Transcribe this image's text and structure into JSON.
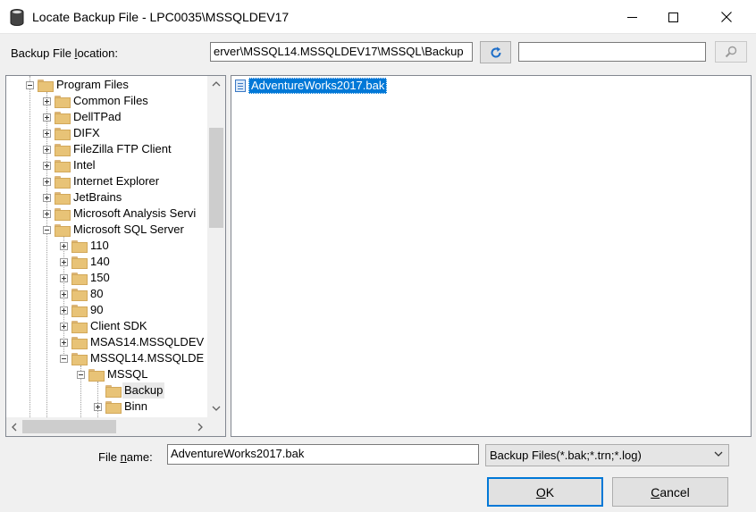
{
  "window": {
    "title": "Locate Backup File - LPC0035\\MSSQLDEV17",
    "icon": "database-icon"
  },
  "location": {
    "label_pre": "Backup File ",
    "label_key": "l",
    "label_post": "ocation:",
    "value": "erver\\MSSQL14.MSSQLDEV17\\MSSQL\\Backup",
    "search_value": ""
  },
  "tree": {
    "items": [
      {
        "label": "Program Files",
        "expander": "minus"
      },
      {
        "label": "Common Files",
        "expander": "plus"
      },
      {
        "label": "DellTPad",
        "expander": "plus"
      },
      {
        "label": "DIFX",
        "expander": "plus"
      },
      {
        "label": "FileZilla FTP Client",
        "expander": "plus"
      },
      {
        "label": "Intel",
        "expander": "plus"
      },
      {
        "label": "Internet Explorer",
        "expander": "plus"
      },
      {
        "label": "JetBrains",
        "expander": "plus"
      },
      {
        "label": "Microsoft Analysis Servi",
        "expander": "plus"
      },
      {
        "label": "Microsoft SQL Server",
        "expander": "minus"
      },
      {
        "label": "110",
        "expander": "plus"
      },
      {
        "label": "140",
        "expander": "plus"
      },
      {
        "label": "150",
        "expander": "plus"
      },
      {
        "label": "80",
        "expander": "plus"
      },
      {
        "label": "90",
        "expander": "plus"
      },
      {
        "label": "Client SDK",
        "expander": "plus"
      },
      {
        "label": "MSAS14.MSSQLDEV",
        "expander": "plus"
      },
      {
        "label": "MSSQL14.MSSQLDE",
        "expander": "minus"
      },
      {
        "label": "MSSQL",
        "expander": "minus"
      },
      {
        "label": "Backup",
        "expander": "none",
        "selected": true
      },
      {
        "label": "Binn",
        "expander": "plus"
      }
    ]
  },
  "files": [
    {
      "name": "AdventureWorks2017.bak",
      "selected": true
    }
  ],
  "file_name": {
    "label_pre": "File ",
    "label_key": "n",
    "label_post": "ame:",
    "value": "AdventureWorks2017.bak"
  },
  "filter": {
    "selected": "Backup Files(*.bak;*.trn;*.log)"
  },
  "buttons": {
    "ok_key": "O",
    "ok_rest": "K",
    "cancel_key": "C",
    "cancel_rest": "ancel"
  },
  "colors": {
    "selection": "#0078d7",
    "folder": "#e8c377"
  }
}
